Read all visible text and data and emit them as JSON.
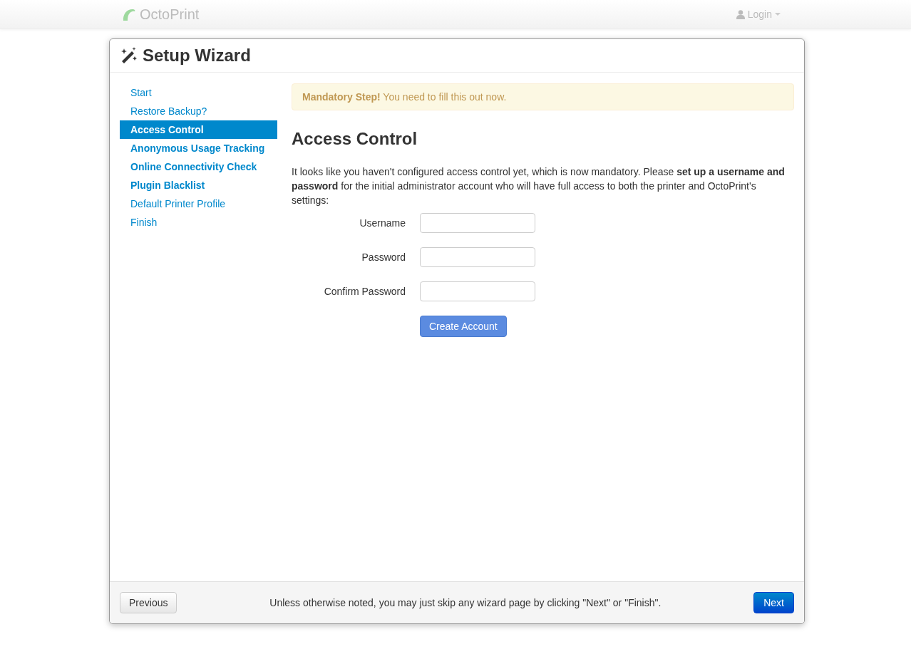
{
  "navbar": {
    "brand": "OctoPrint",
    "login": "Login"
  },
  "wizard": {
    "title": "Setup Wizard",
    "steps": [
      {
        "label": "Start",
        "selected": false,
        "required": false
      },
      {
        "label": "Restore Backup?",
        "selected": false,
        "required": false
      },
      {
        "label": "Access Control",
        "selected": true,
        "required": true
      },
      {
        "label": "Anonymous Usage Tracking",
        "selected": false,
        "required": true
      },
      {
        "label": "Online Connectivity Check",
        "selected": false,
        "required": true
      },
      {
        "label": "Plugin Blacklist",
        "selected": false,
        "required": true
      },
      {
        "label": "Default Printer Profile",
        "selected": false,
        "required": false
      },
      {
        "label": "Finish",
        "selected": false,
        "required": false
      }
    ],
    "alert": "**Mandatory Step!** You need to fill this out now.",
    "heading": "Access Control",
    "intro": "It looks like you haven't configured access control yet, which is now mandatory. Please **set up a username and password** for the initial administrator account who will have full access to both the printer and OctoPrint's settings:",
    "fields": [
      {
        "label": "Username"
      },
      {
        "label": "Password"
      },
      {
        "label": "Confirm Password"
      }
    ],
    "create_button": "Create Account",
    "footer": {
      "previous": "Previous",
      "note": "Unless otherwise noted, you may just skip any wizard page by clicking \"Next\" or \"Finish\".",
      "next": "Next"
    }
  }
}
